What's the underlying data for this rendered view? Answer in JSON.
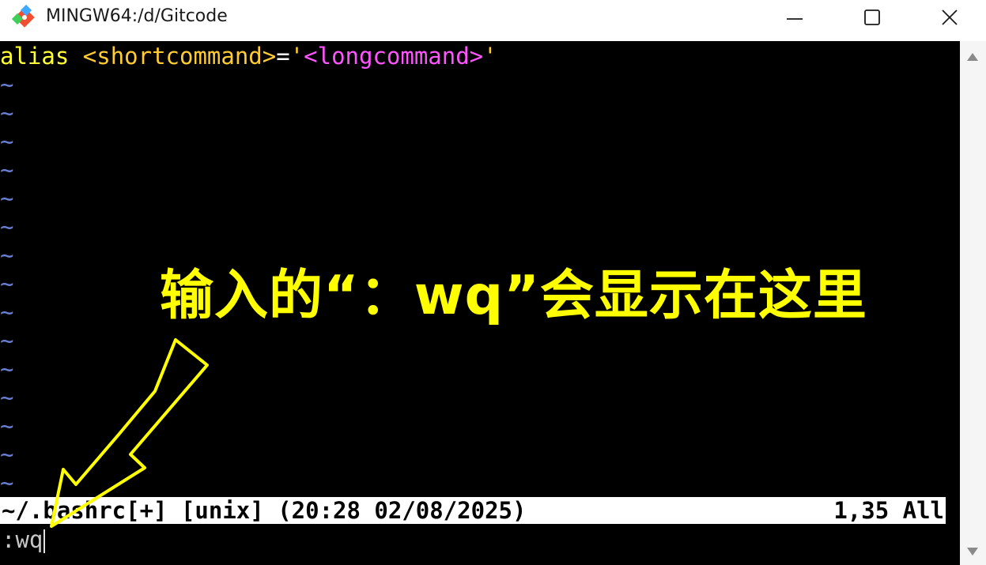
{
  "window": {
    "title": "MINGW64:/d/Gitcode",
    "icon": "git-icon",
    "controls": [
      "minimize-icon",
      "maximize-icon",
      "close-icon"
    ]
  },
  "editor": {
    "line1": {
      "keyword": "alias",
      "space": " ",
      "name": "<shortcommand>",
      "equals": "=",
      "quote_open": "'",
      "value": "<longcommand>",
      "quote_close": "'"
    },
    "tilde": "~",
    "tilde_count": 15,
    "colors": {
      "keyword": "#ffff33",
      "name": "#ffcc33",
      "value": "#ff55ff",
      "tilde": "#6b7fd7"
    }
  },
  "statusline": {
    "left": "~/.bashrc[+] [unix] (20:28 02/08/2025)",
    "right": "1,35 All"
  },
  "command_line": ":wq",
  "annotation": {
    "text": "输入的“：wq”会显示在这里",
    "color": "#ffff00"
  }
}
